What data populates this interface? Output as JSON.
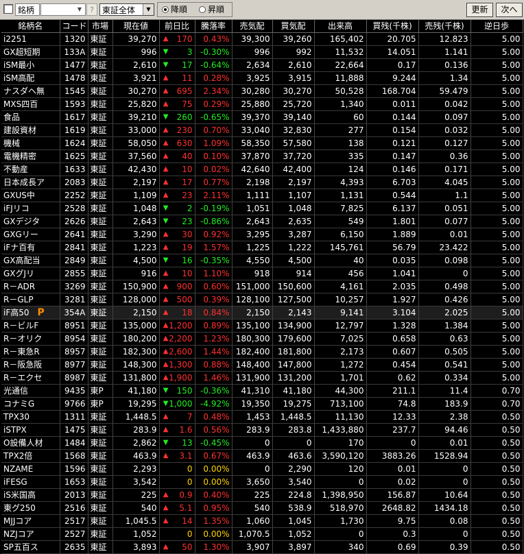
{
  "toolbar": {
    "brand_label": "銘柄",
    "code_value": "",
    "help_label": "?",
    "market_value": "東証全体",
    "order_desc": "降順",
    "order_asc": "昇順",
    "refresh_label": "更新",
    "next_label": "次へ"
  },
  "columns": [
    "銘柄名",
    "コード",
    "市場",
    "現在値",
    "前日比",
    "騰落率",
    "売気配",
    "買気配",
    "出来高",
    "買残(千株)",
    "売残(千株)",
    "逆日歩"
  ],
  "rows": [
    {
      "name": "i2251",
      "code": "1320",
      "market": "東証",
      "price": "39,270",
      "dir": "up",
      "change": "170",
      "rate": "0.43%",
      "ask": "39,300",
      "bid": "39,260",
      "volume": "165,402",
      "buy": "20.705",
      "sell": "12.823",
      "fee": "5.00"
    },
    {
      "name": "GX超短期",
      "code": "133A",
      "market": "東証",
      "price": "996",
      "dir": "dn",
      "change": "3",
      "rate": "-0.30%",
      "ask": "996",
      "bid": "992",
      "volume": "11,532",
      "buy": "14.051",
      "sell": "1.141",
      "fee": "5.00"
    },
    {
      "name": "iSM最小",
      "code": "1477",
      "market": "東証",
      "price": "2,610",
      "dir": "dn",
      "change": "17",
      "rate": "-0.64%",
      "ask": "2,634",
      "bid": "2,610",
      "volume": "22,664",
      "buy": "0.17",
      "sell": "0.136",
      "fee": "5.00"
    },
    {
      "name": "iSM高配",
      "code": "1478",
      "market": "東証",
      "price": "3,921",
      "dir": "up",
      "change": "11",
      "rate": "0.28%",
      "ask": "3,925",
      "bid": "3,915",
      "volume": "11,888",
      "buy": "9.244",
      "sell": "1.34",
      "fee": "5.00"
    },
    {
      "name": "ナスダヘ無",
      "code": "1545",
      "market": "東証",
      "price": "30,270",
      "dir": "up",
      "change": "695",
      "rate": "2.34%",
      "ask": "30,280",
      "bid": "30,270",
      "volume": "50,528",
      "buy": "168.704",
      "sell": "59.479",
      "fee": "5.00"
    },
    {
      "name": "MXS四百",
      "code": "1593",
      "market": "東証",
      "price": "25,820",
      "dir": "up",
      "change": "75",
      "rate": "0.29%",
      "ask": "25,880",
      "bid": "25,720",
      "volume": "1,340",
      "buy": "0.011",
      "sell": "0.042",
      "fee": "5.00"
    },
    {
      "name": "食品",
      "code": "1617",
      "market": "東証",
      "price": "39,210",
      "dir": "dn",
      "change": "260",
      "rate": "-0.65%",
      "ask": "39,370",
      "bid": "39,140",
      "volume": "60",
      "buy": "0.144",
      "sell": "0.097",
      "fee": "5.00"
    },
    {
      "name": "建設資材",
      "code": "1619",
      "market": "東証",
      "price": "33,000",
      "dir": "up",
      "change": "230",
      "rate": "0.70%",
      "ask": "33,040",
      "bid": "32,830",
      "volume": "277",
      "buy": "0.154",
      "sell": "0.032",
      "fee": "5.00"
    },
    {
      "name": "機械",
      "code": "1624",
      "market": "東証",
      "price": "58,050",
      "dir": "up",
      "change": "630",
      "rate": "1.09%",
      "ask": "58,350",
      "bid": "57,580",
      "volume": "138",
      "buy": "0.121",
      "sell": "0.127",
      "fee": "5.00"
    },
    {
      "name": "電機精密",
      "code": "1625",
      "market": "東証",
      "price": "37,560",
      "dir": "up",
      "change": "40",
      "rate": "0.10%",
      "ask": "37,870",
      "bid": "37,720",
      "volume": "335",
      "buy": "0.147",
      "sell": "0.36",
      "fee": "5.00"
    },
    {
      "name": "不動産",
      "code": "1633",
      "market": "東証",
      "price": "42,430",
      "dir": "up",
      "change": "10",
      "rate": "0.02%",
      "ask": "42,640",
      "bid": "42,400",
      "volume": "124",
      "buy": "0.146",
      "sell": "0.171",
      "fee": "5.00"
    },
    {
      "name": "日本成長ア",
      "code": "2083",
      "market": "東証",
      "price": "2,197",
      "dir": "up",
      "change": "17",
      "rate": "0.77%",
      "ask": "2,198",
      "bid": "2,197",
      "volume": "4,393",
      "buy": "6.703",
      "sell": "4.045",
      "fee": "5.00"
    },
    {
      "name": "GXUS中",
      "code": "2252",
      "market": "東証",
      "price": "1,109",
      "dir": "up",
      "change": "23",
      "rate": "2.11%",
      "ask": "1,111",
      "bid": "1,107",
      "volume": "1,131",
      "buy": "0.544",
      "sell": "1.1",
      "fee": "5.00"
    },
    {
      "name": "iFJリコ",
      "code": "2528",
      "market": "東証",
      "price": "1,048",
      "dir": "dn",
      "change": "2",
      "rate": "-0.19%",
      "ask": "1,051",
      "bid": "1,048",
      "volume": "7,825",
      "buy": "6.137",
      "sell": "0.051",
      "fee": "5.00"
    },
    {
      "name": "GXデジタ",
      "code": "2626",
      "market": "東証",
      "price": "2,643",
      "dir": "dn",
      "change": "23",
      "rate": "-0.86%",
      "ask": "2,643",
      "bid": "2,635",
      "volume": "549",
      "buy": "1.801",
      "sell": "0.077",
      "fee": "5.00"
    },
    {
      "name": "GXGリー",
      "code": "2641",
      "market": "東証",
      "price": "3,290",
      "dir": "up",
      "change": "30",
      "rate": "0.92%",
      "ask": "3,295",
      "bid": "3,287",
      "volume": "6,150",
      "buy": "1.889",
      "sell": "0.01",
      "fee": "5.00"
    },
    {
      "name": "iFナ百有",
      "code": "2841",
      "market": "東証",
      "price": "1,223",
      "dir": "up",
      "change": "19",
      "rate": "1.57%",
      "ask": "1,225",
      "bid": "1,222",
      "volume": "145,761",
      "buy": "56.79",
      "sell": "23.422",
      "fee": "5.00"
    },
    {
      "name": "GX高配当",
      "code": "2849",
      "market": "東証",
      "price": "4,500",
      "dir": "dn",
      "change": "16",
      "rate": "-0.35%",
      "ask": "4,550",
      "bid": "4,500",
      "volume": "40",
      "buy": "0.035",
      "sell": "0.098",
      "fee": "5.00"
    },
    {
      "name": "GXグJリ",
      "code": "2855",
      "market": "東証",
      "price": "916",
      "dir": "up",
      "change": "10",
      "rate": "1.10%",
      "ask": "918",
      "bid": "914",
      "volume": "456",
      "buy": "1.041",
      "sell": "0",
      "fee": "5.00"
    },
    {
      "name": "R－ADR",
      "code": "3269",
      "market": "東証",
      "price": "150,900",
      "dir": "up",
      "change": "900",
      "rate": "0.60%",
      "ask": "151,000",
      "bid": "150,600",
      "volume": "4,161",
      "buy": "2.035",
      "sell": "0.498",
      "fee": "5.00"
    },
    {
      "name": "R－GLP",
      "code": "3281",
      "market": "東証",
      "price": "128,000",
      "dir": "up",
      "change": "500",
      "rate": "0.39%",
      "ask": "128,100",
      "bid": "127,500",
      "volume": "10,257",
      "buy": "1.927",
      "sell": "0.426",
      "fee": "5.00"
    },
    {
      "name": "iF高50",
      "code": "354A",
      "market": "東証",
      "price": "2,150",
      "dir": "up",
      "change": "18",
      "rate": "0.84%",
      "ask": "2,150",
      "bid": "2,143",
      "volume": "9,141",
      "buy": "3.104",
      "sell": "2.025",
      "fee": "5.00",
      "badge": "P"
    },
    {
      "name": "R－ビルF",
      "code": "8951",
      "market": "東証",
      "price": "135,000",
      "dir": "up",
      "change": "1,200",
      "rate": "0.89%",
      "ask": "135,100",
      "bid": "134,900",
      "volume": "12,797",
      "buy": "1.328",
      "sell": "1.384",
      "fee": "5.00"
    },
    {
      "name": "R－オリク",
      "code": "8954",
      "market": "東証",
      "price": "180,200",
      "dir": "up",
      "change": "2,200",
      "rate": "1.23%",
      "ask": "180,300",
      "bid": "179,600",
      "volume": "7,025",
      "buy": "0.658",
      "sell": "0.63",
      "fee": "5.00"
    },
    {
      "name": "R－東急R",
      "code": "8957",
      "market": "東証",
      "price": "182,300",
      "dir": "up",
      "change": "2,600",
      "rate": "1.44%",
      "ask": "182,400",
      "bid": "181,800",
      "volume": "2,173",
      "buy": "0.607",
      "sell": "0.505",
      "fee": "5.00"
    },
    {
      "name": "R－阪急阪",
      "code": "8977",
      "market": "東証",
      "price": "148,300",
      "dir": "up",
      "change": "1,300",
      "rate": "0.88%",
      "ask": "148,400",
      "bid": "147,800",
      "volume": "1,272",
      "buy": "0.454",
      "sell": "0.541",
      "fee": "5.00"
    },
    {
      "name": "R－エクセ",
      "code": "8987",
      "market": "東証",
      "price": "131,800",
      "dir": "up",
      "change": "1,900",
      "rate": "1.46%",
      "ask": "131,900",
      "bid": "131,200",
      "volume": "1,701",
      "buy": "0.62",
      "sell": "0.334",
      "fee": "5.00"
    },
    {
      "name": "光通信",
      "code": "9435",
      "market": "東P",
      "price": "41,180",
      "dir": "dn",
      "change": "150",
      "rate": "-0.36%",
      "ask": "41,310",
      "bid": "41,180",
      "volume": "44,300",
      "buy": "211.1",
      "sell": "11.4",
      "fee": "0.70"
    },
    {
      "name": "コナミG",
      "code": "9766",
      "market": "東P",
      "price": "19,295",
      "dir": "dn",
      "change": "1,000",
      "rate": "-4.92%",
      "ask": "19,350",
      "bid": "19,275",
      "volume": "713,100",
      "buy": "74.8",
      "sell": "183.9",
      "fee": "0.70"
    },
    {
      "name": "TPX30",
      "code": "1311",
      "market": "東証",
      "price": "1,448.5",
      "dir": "up",
      "change": "7",
      "rate": "0.48%",
      "ask": "1,453",
      "bid": "1,448.5",
      "volume": "11,130",
      "buy": "12.33",
      "sell": "2.38",
      "fee": "0.50"
    },
    {
      "name": "iSTPX",
      "code": "1475",
      "market": "東証",
      "price": "283.9",
      "dir": "up",
      "change": "1.6",
      "rate": "0.56%",
      "ask": "283.9",
      "bid": "283.8",
      "volume": "1,433,880",
      "buy": "237.7",
      "sell": "94.46",
      "fee": "0.50"
    },
    {
      "name": "O設備人材",
      "code": "1484",
      "market": "東証",
      "price": "2,862",
      "dir": "dn",
      "change": "13",
      "rate": "-0.45%",
      "ask": "0",
      "bid": "0",
      "volume": "170",
      "buy": "0",
      "sell": "0.01",
      "fee": "0.50"
    },
    {
      "name": "TPX2倍",
      "code": "1568",
      "market": "東証",
      "price": "463.9",
      "dir": "up",
      "change": "3.1",
      "rate": "0.67%",
      "ask": "463.9",
      "bid": "463.6",
      "volume": "3,590,120",
      "buy": "3883.26",
      "sell": "1528.94",
      "fee": "0.50"
    },
    {
      "name": "NZAME",
      "code": "1596",
      "market": "東証",
      "price": "2,293",
      "dir": "flat",
      "change": "0",
      "rate": "0.00%",
      "ask": "0",
      "bid": "2,290",
      "volume": "120",
      "buy": "0.01",
      "sell": "0",
      "fee": "0.50"
    },
    {
      "name": "iFESG",
      "code": "1653",
      "market": "東証",
      "price": "3,542",
      "dir": "flat",
      "change": "0",
      "rate": "0.00%",
      "ask": "3,650",
      "bid": "3,540",
      "volume": "0",
      "buy": "0.02",
      "sell": "0",
      "fee": "0.50"
    },
    {
      "name": "iS米国高",
      "code": "2013",
      "market": "東証",
      "price": "225",
      "dir": "up",
      "change": "0.9",
      "rate": "0.40%",
      "ask": "225",
      "bid": "224.8",
      "volume": "1,398,950",
      "buy": "156.87",
      "sell": "10.64",
      "fee": "0.50"
    },
    {
      "name": "東グ250",
      "code": "2516",
      "market": "東証",
      "price": "540",
      "dir": "up",
      "change": "5.1",
      "rate": "0.95%",
      "ask": "540",
      "bid": "538.9",
      "volume": "518,970",
      "buy": "2648.82",
      "sell": "1434.18",
      "fee": "0.50"
    },
    {
      "name": "MJJコア",
      "code": "2517",
      "market": "東証",
      "price": "1,045.5",
      "dir": "up",
      "change": "14",
      "rate": "1.35%",
      "ask": "1,060",
      "bid": "1,045",
      "volume": "1,730",
      "buy": "9.75",
      "sell": "0.08",
      "fee": "0.50"
    },
    {
      "name": "NZJコア",
      "code": "2527",
      "market": "東証",
      "price": "1,052",
      "dir": "flat",
      "change": "0",
      "rate": "0.00%",
      "ask": "1,070.5",
      "bid": "1,052",
      "volume": "0",
      "buy": "0.3",
      "sell": "0",
      "fee": "0.50"
    },
    {
      "name": "SP五百ス",
      "code": "2635",
      "market": "東証",
      "price": "3,893",
      "dir": "up",
      "change": "50",
      "rate": "1.30%",
      "ask": "3,907",
      "bid": "3,897",
      "volume": "340",
      "buy": "0.69",
      "sell": "0.39",
      "fee": "0.50"
    }
  ],
  "arrow_glyphs": {
    "up": "▲",
    "dn": "▼",
    "flat": ""
  },
  "colors": {
    "up": "#ff3030",
    "down": "#22ee22",
    "flat": "#ffd800",
    "text": "#ffffff",
    "background": "#000000",
    "badge": "#ff8c00"
  }
}
